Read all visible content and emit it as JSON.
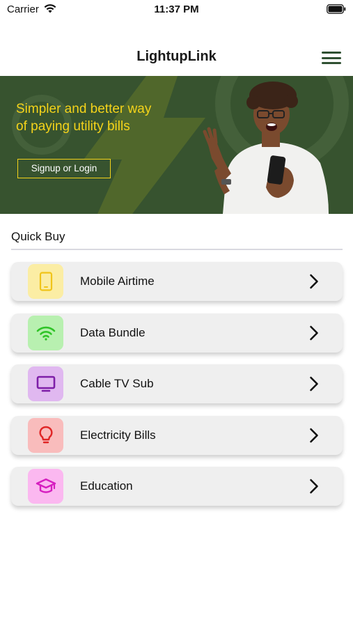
{
  "status": {
    "carrier": "Carrier",
    "time": "11:37 PM"
  },
  "header": {
    "title": "LightupLink"
  },
  "banner": {
    "headline": "Simpler and better way of paying utility bills",
    "cta": "Signup or Login"
  },
  "quick_buy": {
    "title": "Quick Buy",
    "items": [
      {
        "label": "Mobile Airtime",
        "icon": "mobile-phone-icon",
        "icon_bg": "#fbeda4",
        "icon_color": "#f0c419"
      },
      {
        "label": "Data Bundle",
        "icon": "wifi-icon",
        "icon_bg": "#b8f0b0",
        "icon_color": "#2fc427"
      },
      {
        "label": "Cable TV Sub",
        "icon": "tv-icon",
        "icon_bg": "#e0b8f0",
        "icon_color": "#7e1ea8"
      },
      {
        "label": "Electricity Bills",
        "icon": "lightbulb-icon",
        "icon_bg": "#f9bcbc",
        "icon_color": "#e02626"
      },
      {
        "label": "Education",
        "icon": "graduation-cap-icon",
        "icon_bg": "#fbb8f0",
        "icon_color": "#d61ec0"
      }
    ]
  }
}
